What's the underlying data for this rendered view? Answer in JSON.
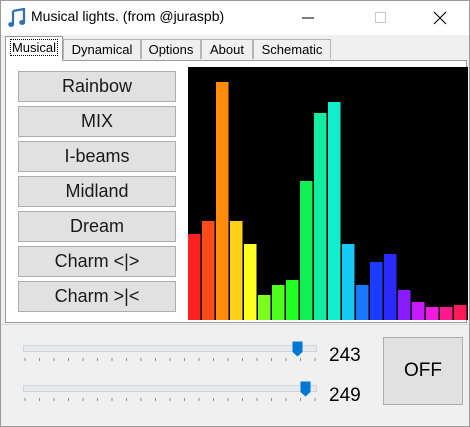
{
  "window": {
    "title": "Musical lights. (from @juraspb)",
    "icon": "music-note-icon",
    "controls": [
      "minimize-icon",
      "maximize-icon",
      "close-icon"
    ]
  },
  "tabs": [
    {
      "label": "Musical",
      "active": true
    },
    {
      "label": "Dynamical",
      "active": false
    },
    {
      "label": "Options",
      "active": false
    },
    {
      "label": "About",
      "active": false
    },
    {
      "label": "Schematic",
      "active": false
    }
  ],
  "mode_buttons": [
    "Rainbow",
    "MIX",
    "I-beams",
    "Midland",
    "Dream",
    "Charm <|>",
    "Charm >|<"
  ],
  "visualizer": {
    "background": "#000000",
    "bars": [
      {
        "level": 0.34,
        "color": "#ff2020"
      },
      {
        "level": 0.39,
        "color": "#ff4a1a"
      },
      {
        "level": 0.94,
        "color": "#ff8c0a"
      },
      {
        "level": 0.39,
        "color": "#ffd21a"
      },
      {
        "level": 0.3,
        "color": "#ffff22"
      },
      {
        "level": 0.1,
        "color": "#7cff1c"
      },
      {
        "level": 0.14,
        "color": "#4dff1c"
      },
      {
        "level": 0.16,
        "color": "#22ff22"
      },
      {
        "level": 0.55,
        "color": "#10f055"
      },
      {
        "level": 0.82,
        "color": "#12eea0"
      },
      {
        "level": 0.86,
        "color": "#10eecc"
      },
      {
        "level": 0.3,
        "color": "#16c8f2"
      },
      {
        "level": 0.14,
        "color": "#1a78ff"
      },
      {
        "level": 0.23,
        "color": "#1a3cff"
      },
      {
        "level": 0.26,
        "color": "#2a2aff"
      },
      {
        "level": 0.12,
        "color": "#8a1aff"
      },
      {
        "level": 0.07,
        "color": "#c81aff"
      },
      {
        "level": 0.05,
        "color": "#f01ae0"
      },
      {
        "level": 0.05,
        "color": "#ff1a8c"
      },
      {
        "level": 0.06,
        "color": "#ff1a5a"
      }
    ]
  },
  "sliders": [
    {
      "name": "slider-1",
      "value": "243",
      "position": 0.95
    },
    {
      "name": "slider-2",
      "value": "249",
      "position": 0.98
    }
  ],
  "power_button": {
    "label": "OFF"
  },
  "colors": {
    "accent": "#0078d7",
    "window_bg": "#f0f0f0",
    "button_bg": "#e1e1e1"
  }
}
